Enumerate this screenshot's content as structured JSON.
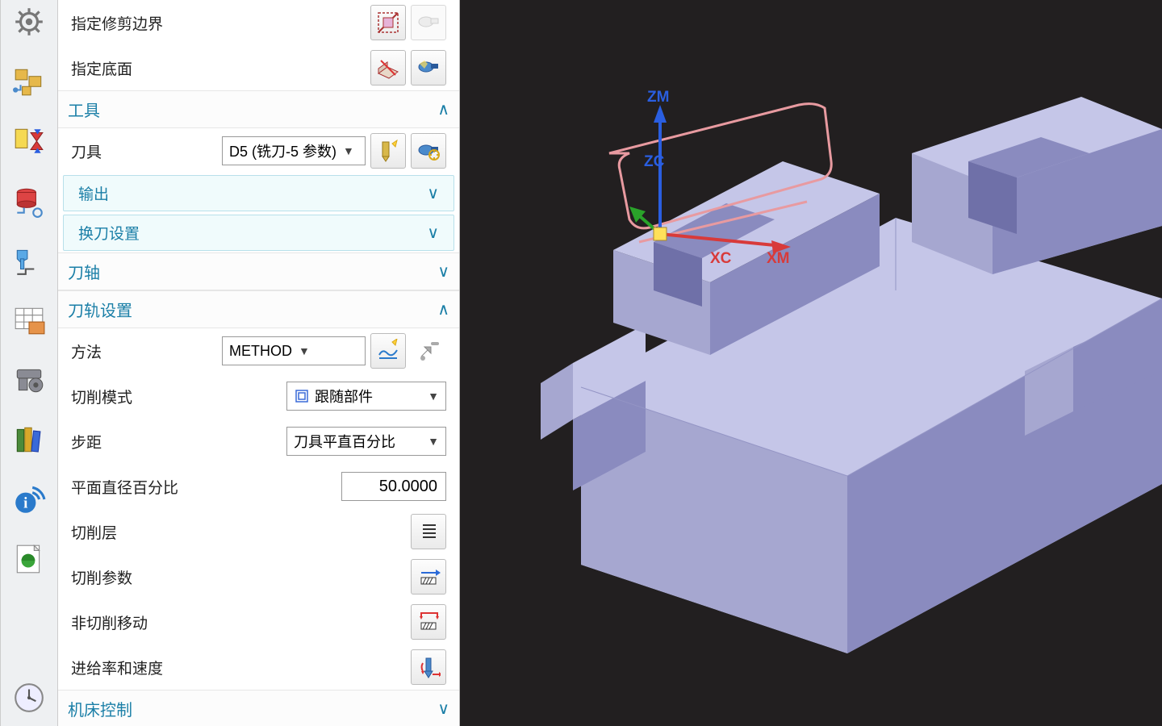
{
  "geometry": {
    "trim_boundary_label": "指定修剪边界",
    "floor_label": "指定底面"
  },
  "tool": {
    "section_label": "工具",
    "tool_label": "刀具",
    "tool_selected": "D5 (铣刀-5 参数)",
    "output_label": "输出",
    "tool_change_label": "换刀设置"
  },
  "axis": {
    "section_label": "刀轴"
  },
  "path": {
    "section_label": "刀轨设置",
    "method_label": "方法",
    "method_selected": "METHOD",
    "cut_pattern_label": "切削模式",
    "cut_pattern_selected": "跟随部件",
    "stepover_label": "步距",
    "stepover_selected": "刀具平直百分比",
    "percent_label": "平面直径百分比",
    "percent_value": "50.0000",
    "cut_levels_label": "切削层",
    "cut_params_label": "切削参数",
    "noncut_moves_label": "非切削移动",
    "feeds_label": "进给率和速度"
  },
  "machine": {
    "section_label": "机床控制"
  },
  "viewport": {
    "axes": {
      "z": "ZM",
      "zc": "ZC",
      "x": "XM",
      "xc": "XC"
    },
    "colors": {
      "bg": "#221f20",
      "part_fill": "#c5c6e8",
      "part_shade": "#a6a7d0",
      "part_dark": "#8a8bbf",
      "outline": "#e89aa0",
      "z_axis": "#2a5ee0",
      "x_axis": "#d83a3a",
      "y_axis": "#2aa32a"
    }
  }
}
